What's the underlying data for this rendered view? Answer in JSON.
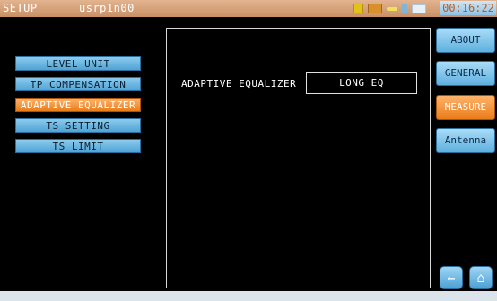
{
  "header": {
    "title": "SETUP",
    "user": "usrp1n00",
    "clock": "00:16:22",
    "status_icons": [
      "wifi-icon",
      "usb-icon",
      "plug-icon",
      "antenna-status-icon",
      "battery-icon"
    ]
  },
  "menu": {
    "items": [
      {
        "label": "LEVEL UNIT",
        "active": false
      },
      {
        "label": "TP COMPENSATION",
        "active": false
      },
      {
        "label": "ADAPTIVE EQUALIZER",
        "active": true
      },
      {
        "label": "TS SETTING",
        "active": false
      },
      {
        "label": "TS LIMIT",
        "active": false
      }
    ]
  },
  "panel": {
    "setting_label": "ADAPTIVE EQUALIZER",
    "setting_value": "LONG EQ"
  },
  "tabs": {
    "items": [
      {
        "label": "ABOUT",
        "active": false
      },
      {
        "label": "GENERAL",
        "active": false
      },
      {
        "label": "MEASURE",
        "active": true
      },
      {
        "label": "Antenna",
        "active": false
      }
    ]
  },
  "nav": {
    "back_icon": "back-arrow-icon",
    "home_icon": "home-icon"
  },
  "colors": {
    "accent_active": "#ea7d1a",
    "button_blue": "#4fa3d6",
    "topbar": "#c98f66",
    "clock_text": "#c0581c"
  }
}
